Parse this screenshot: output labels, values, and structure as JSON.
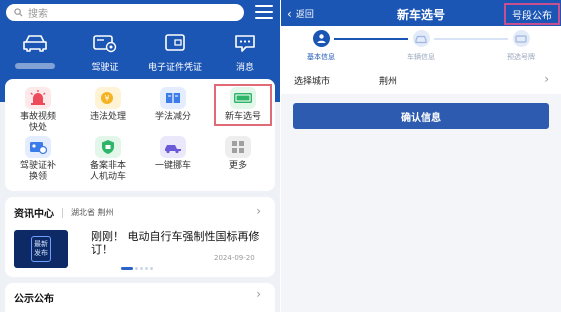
{
  "left": {
    "search_placeholder": "搜索",
    "quick": [
      {
        "icon": "car-icon",
        "label": ""
      },
      {
        "icon": "driver-license-icon",
        "label": "驾驶证"
      },
      {
        "icon": "wallet-icon",
        "label": "电子证件凭证"
      },
      {
        "icon": "message-icon",
        "label": "消息"
      }
    ],
    "services": [
      {
        "icon": "alarm-icon",
        "label1": "事故视频",
        "label2": "快处"
      },
      {
        "icon": "violation-icon",
        "label1": "违法处理",
        "label2": ""
      },
      {
        "icon": "study-book-icon",
        "label1": "学法减分",
        "label2": ""
      },
      {
        "icon": "new-plate-icon",
        "label1": "新车选号",
        "label2": ""
      },
      {
        "icon": "license-renew-icon",
        "label1": "驾驶证补",
        "label2": "换领"
      },
      {
        "icon": "shield-icon",
        "label1": "备案非本",
        "label2": "人机动车"
      },
      {
        "icon": "tow-car-icon",
        "label1": "一键挪车",
        "label2": ""
      },
      {
        "icon": "more-icon",
        "label1": "更多",
        "label2": ""
      }
    ],
    "news": {
      "title": "资讯中心",
      "location": "湖北省 荆州",
      "thumb_text": "最新发布",
      "headline": "刚刚！ 电动自行车强制性国标再修订！",
      "date": "2024-09-20"
    },
    "notice_title": "公示公布"
  },
  "right": {
    "back_label": "返回",
    "title": "新车选号",
    "segment_button": "号段公布",
    "steps": [
      {
        "label": "基本信息",
        "active": true
      },
      {
        "label": "车辆信息",
        "active": false
      },
      {
        "label": "预选号牌",
        "active": false
      }
    ],
    "city_label": "选择城市",
    "city_value": "荆州",
    "confirm_label": "确认信息"
  }
}
